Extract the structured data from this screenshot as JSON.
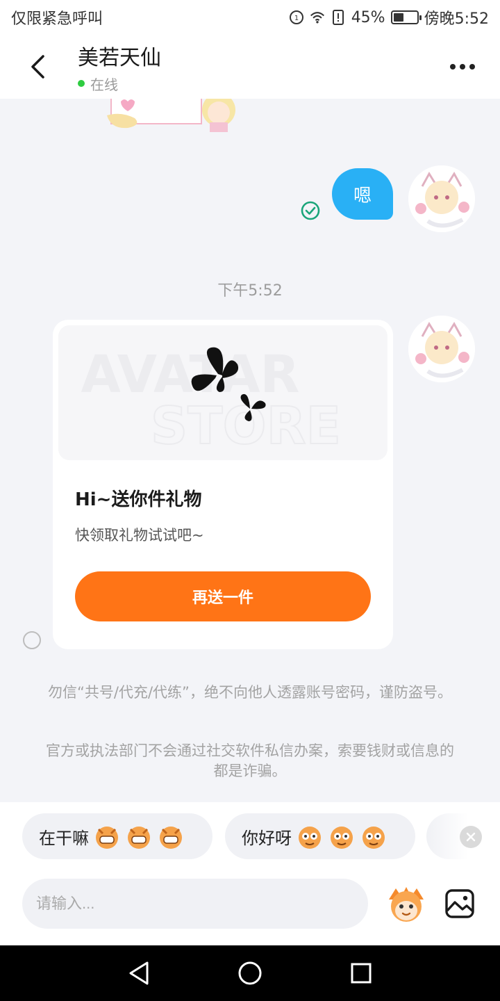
{
  "status_bar": {
    "carrier": "仅限紧急呼叫",
    "battery": "45%",
    "battery_level": 0.45,
    "time": "傍晚5:52"
  },
  "header": {
    "title": "美若天仙",
    "status": "在线",
    "icons": {
      "back": "chevron-left-icon",
      "more": "more-dots-icon"
    }
  },
  "chat": {
    "outgoing_message": "嗯",
    "timestamp": "下午5:52",
    "gift_card": {
      "title": "Hi~送你件礼物",
      "subtitle": "快领取礼物试试吧~",
      "button_label": "再送一件"
    },
    "notices": [
      "勿信“共号/代充/代练”，绝不向他人透露账号密码，谨防盗号。",
      "官方或执法部门不会通过社交软件私信办案，索要钱财或信息的都是诈骗。"
    ]
  },
  "quick_replies": [
    {
      "label": "在干嘛"
    },
    {
      "label": "你好呀"
    }
  ],
  "input": {
    "placeholder": "请输入..."
  },
  "colors": {
    "accent_orange": "#ff7416",
    "bubble_blue": "#29b0f5",
    "online_green": "#2ecc40",
    "read_green": "#1aa57a"
  }
}
